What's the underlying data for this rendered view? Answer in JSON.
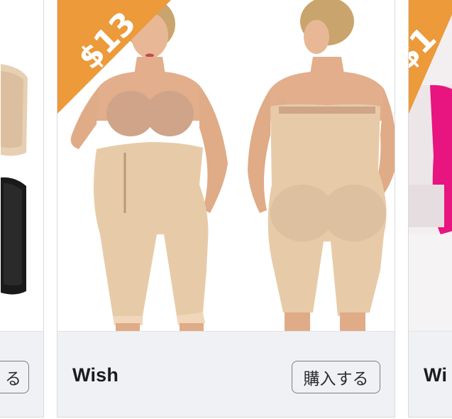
{
  "cards": [
    {
      "position": "left",
      "button_label": "る"
    },
    {
      "position": "center",
      "price_badge": "$13",
      "brand": "Wish",
      "button_label": "購入する"
    },
    {
      "position": "right",
      "price_badge": "$1",
      "brand": "Wi"
    }
  ],
  "colors": {
    "badge": "#ec9a3a",
    "footer_bg": "#f0f1f4",
    "button_border": "#7a7d83",
    "skin_tone_garment": "#e7cba8"
  }
}
